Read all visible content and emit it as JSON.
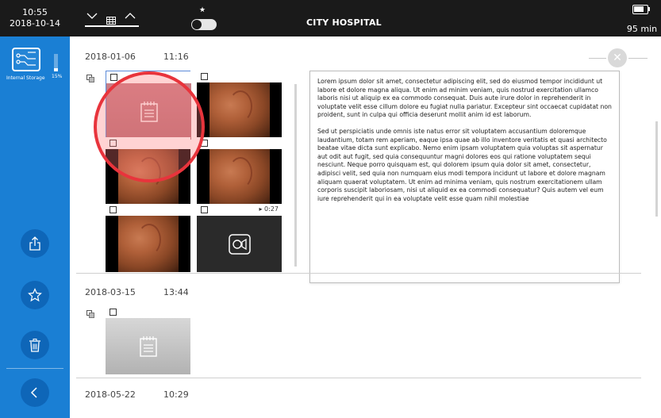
{
  "status_bar": {
    "time": "10:55",
    "date": "2018-10-14",
    "title": "CITY HOSPITAL",
    "battery_time": "95 min",
    "battery_level": 0.68
  },
  "sidebar": {
    "storage_label": "Internal Storage",
    "storage_percent": "15%",
    "icons": [
      "share-icon",
      "star-icon",
      "trash-icon",
      "back-chevron-icon"
    ]
  },
  "sessions": [
    {
      "date": "2018-01-06",
      "time": "11:16",
      "items": [
        {
          "kind": "note",
          "selected": true
        },
        {
          "kind": "image"
        },
        {
          "kind": "image"
        },
        {
          "kind": "image"
        },
        {
          "kind": "image"
        },
        {
          "kind": "video",
          "duration": "▸ 0:27"
        }
      ]
    },
    {
      "date": "2018-03-15",
      "time": "13:44",
      "items": [
        {
          "kind": "note"
        }
      ]
    },
    {
      "date": "2018-05-22",
      "time": "10:29",
      "items": []
    }
  ],
  "note_text": {
    "p1": "Lorem ipsum dolor sit amet, consectetur adipiscing elit, sed do eiusmod tempor incididunt ut labore et dolore magna aliqua. Ut enim ad minim veniam, quis nostrud exercitation ullamco laboris nisi ut aliquip ex ea commodo consequat. Duis aute irure dolor in reprehenderit in voluptate velit esse cillum dolore eu fugiat nulla pariatur. Excepteur sint occaecat cupidatat non proident, sunt in culpa qui officia deserunt mollit anim id est laborum.",
    "p2": "Sed ut perspiciatis unde omnis iste natus error sit voluptatem accusantium doloremque laudantium, totam rem aperiam, eaque ipsa quae ab illo inventore veritatis et quasi architecto beatae vitae dicta sunt explicabo. Nemo enim ipsam voluptatem quia voluptas sit aspernatur aut odit aut fugit, sed quia consequuntur magni dolores eos qui ratione voluptatem sequi nesciunt. Neque porro quisquam est, qui dolorem ipsum quia dolor sit amet, consectetur, adipisci velit, sed quia non numquam eius modi tempora incidunt ut labore et dolore magnam aliquam quaerat voluptatem. Ut enim ad minima veniam, quis nostrum exercitationem ullam corporis suscipit laboriosam, nisi ut aliquid ex ea commodi consequatur? Quis autem vel eum iure reprehenderit qui in ea voluptate velit esse quam nihil molestiae"
  },
  "colors": {
    "sidebar": "#1a7fd4",
    "sidebar_button": "#0e66b8",
    "topbar": "#1a1a1a",
    "highlight": "#e8343c",
    "selection": "#5b8bd8"
  }
}
